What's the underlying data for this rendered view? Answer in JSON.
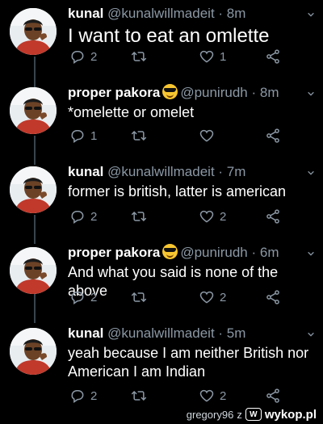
{
  "tweets": [
    {
      "name": "kunal",
      "handle": "@kunalwillmadeit",
      "time": "· 8m",
      "text": "I want to eat an omlette",
      "replies": "2",
      "retweets": "",
      "likes": "1",
      "has_emoji": false
    },
    {
      "name": "proper pakora",
      "handle": "@punirudh",
      "time": "· 8m",
      "text": "*omelette or omelet",
      "replies": "1",
      "retweets": "",
      "likes": "",
      "has_emoji": true
    },
    {
      "name": "kunal",
      "handle": "@kunalwillmadeit",
      "time": "· 7m",
      "text": "former is british, latter is american",
      "replies": "2",
      "retweets": "",
      "likes": "2",
      "has_emoji": false
    },
    {
      "name": "proper pakora",
      "handle": "@punirudh",
      "time": "· 6m",
      "text": "And what you said is none of the above",
      "replies": "2",
      "retweets": "",
      "likes": "2",
      "has_emoji": true
    },
    {
      "name": "kunal",
      "handle": "@kunalwillmadeit",
      "time": "· 5m",
      "text": "yeah because I am neither British nor American I am Indian",
      "replies": "2",
      "retweets": "",
      "likes": "2",
      "has_emoji": false
    }
  ],
  "icons": {
    "reply": "reply-icon",
    "retweet": "retweet-icon",
    "like": "heart-icon",
    "share": "share-icon",
    "menu": "chevron-down-icon",
    "emoji": "sunglasses-emoji"
  },
  "watermark": {
    "user": "gregory96",
    "sep": "z",
    "site": "wykop.pl"
  },
  "colors": {
    "background": "#000000",
    "text": "#ffffff",
    "muted": "#8b98a5",
    "thread_line": "#38444d"
  }
}
